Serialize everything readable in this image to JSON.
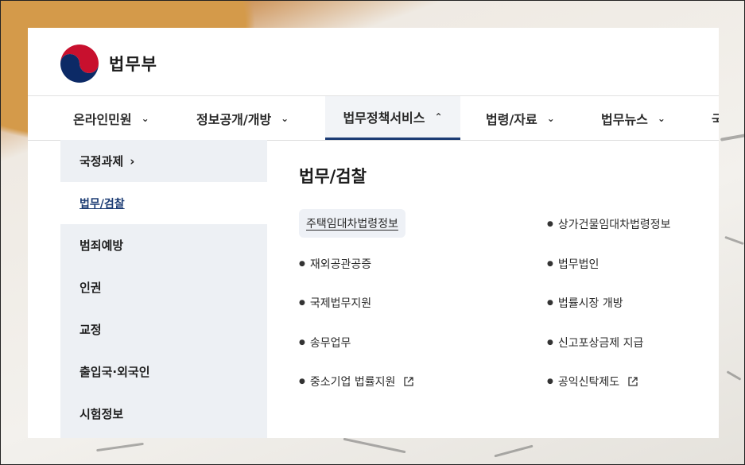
{
  "brand": {
    "name": "법무부"
  },
  "nav": {
    "items": [
      {
        "label": "온라인민원"
      },
      {
        "label": "정보공개/개방"
      },
      {
        "label": "법무정책서비스"
      },
      {
        "label": "법령/자료"
      },
      {
        "label": "법무뉴스"
      }
    ]
  },
  "sidebar": {
    "items": [
      {
        "label": "국정과제"
      },
      {
        "label": "법무/검찰"
      },
      {
        "label": "범죄예방"
      },
      {
        "label": "인권"
      },
      {
        "label": "교정"
      },
      {
        "label": "출입국·외국인"
      },
      {
        "label": "시험정보"
      }
    ]
  },
  "content": {
    "title": "법무/검찰",
    "links_left": [
      {
        "label": "주택임대차법령정보"
      },
      {
        "label": "재외공관공증"
      },
      {
        "label": "국제법무지원"
      },
      {
        "label": "송무업무"
      },
      {
        "label": "중소기업 법률지원"
      }
    ],
    "links_right": [
      {
        "label": "상가건물임대차법령정보"
      },
      {
        "label": "법무법인"
      },
      {
        "label": "법률시장 개방"
      },
      {
        "label": "신고포상금제 지급"
      },
      {
        "label": "공익신탁제도"
      }
    ]
  },
  "colors": {
    "accent": "#1c3c74",
    "sidebar_bg": "#edf0f4"
  }
}
